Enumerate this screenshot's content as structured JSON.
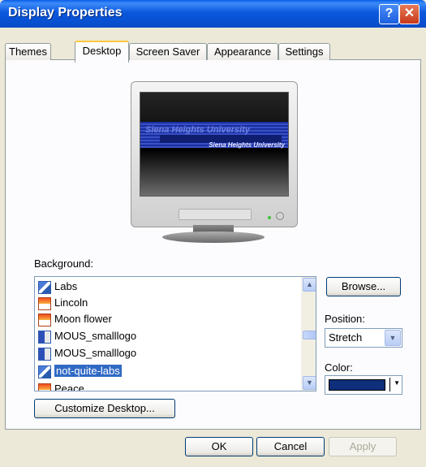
{
  "window": {
    "title": "Display Properties",
    "help_glyph": "?",
    "close_glyph": "✕"
  },
  "tabs": [
    {
      "label": "Themes"
    },
    {
      "label": "Desktop"
    },
    {
      "label": "Screen Saver"
    },
    {
      "label": "Appearance"
    },
    {
      "label": "Settings"
    }
  ],
  "active_tab": "Desktop",
  "preview": {
    "wallpaper_text_large": "Siena Heights University",
    "wallpaper_text_small": "Siena Heights University"
  },
  "background": {
    "label": "Background:",
    "items": [
      {
        "label": "Labs",
        "icon": "shortcut-icon"
      },
      {
        "label": "Lincoln",
        "icon": "picture-icon"
      },
      {
        "label": "Moon flower",
        "icon": "picture-icon"
      },
      {
        "label": "MOUS_smalllogo",
        "icon": "bitmap-icon"
      },
      {
        "label": "MOUS_smalllogo",
        "icon": "bitmap-icon"
      },
      {
        "label": "not-quite-labs",
        "icon": "shortcut-icon",
        "selected": true
      },
      {
        "label": "Peace",
        "icon": "picture-icon"
      }
    ],
    "browse_label": "Browse...",
    "position_label": "Position:",
    "position_value": "Stretch",
    "color_label": "Color:",
    "color_value": "#0F2F7A"
  },
  "customize_label": "Customize Desktop...",
  "buttons": {
    "ok": "OK",
    "cancel": "Cancel",
    "apply": "Apply"
  },
  "glyphs": {
    "up": "▲",
    "down": "▼"
  }
}
